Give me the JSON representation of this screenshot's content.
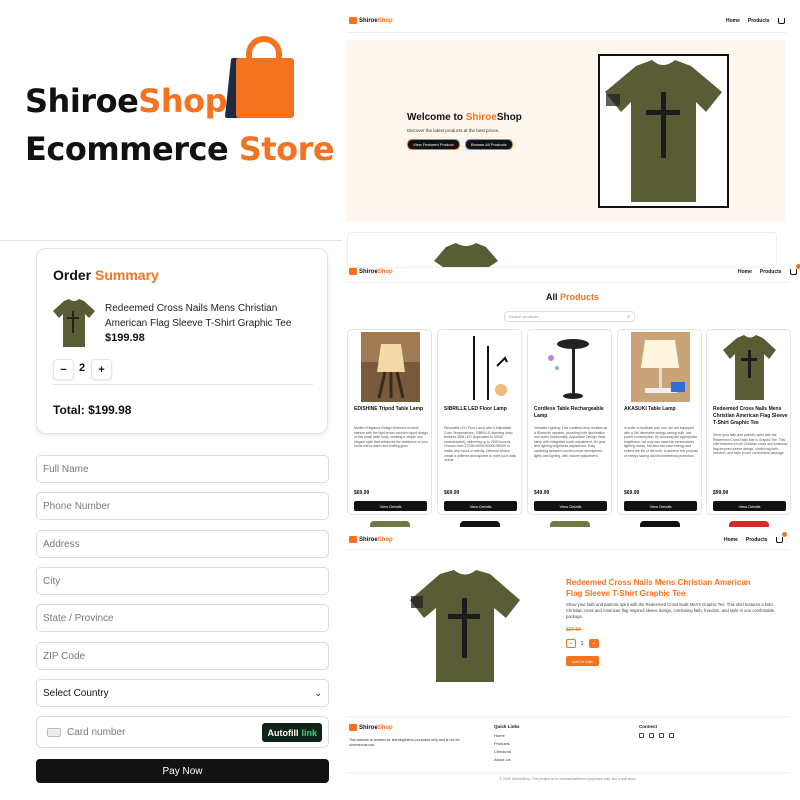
{
  "brand": {
    "line1_a": "Shiroe",
    "line1_b": "Shop",
    "line2_a": "Ecommerce",
    "line2_b": "Store"
  },
  "order": {
    "title_a": "Order",
    "title_b": "Summary",
    "item_title": "Redeemed Cross Nails Mens Christian American Flag Sleeve T-Shirt Graphic Tee",
    "item_price": "$199.98",
    "qty_minus": "−",
    "qty_value": "2",
    "qty_plus": "+",
    "total": "Total: $199.98"
  },
  "checkout": {
    "full_name": "Full Name",
    "phone": "Phone Number",
    "address": "Address",
    "city": "City",
    "state": "State / Province",
    "zip": "ZIP Code",
    "country": "Select Country",
    "card_number": "Card number",
    "autofill": "Autofill",
    "autofill_link": "link",
    "pay": "Pay Now"
  },
  "site": {
    "logo_a": "Shiroe",
    "logo_b": "Shop",
    "nav_home": "Home",
    "nav_products": "Products"
  },
  "hero": {
    "welcome": "Welcome to ",
    "welcome_a": "Shiroe",
    "welcome_b": "Shop",
    "subtitle": "Discover the latest products at the best prices.",
    "btn_featured": "View Featured Product",
    "btn_browse": "Browse All Products"
  },
  "products": {
    "title_a": "All",
    "title_b": "Products",
    "search_placeholder": "Search products...",
    "view_label": "View Details",
    "items": [
      {
        "name": "EDISHINE Tripod Table Lamp",
        "desc": "Modern Elegance Design:Embrace modern fashion with the light brown wooden tripod design of this small table lamp, creating a simple and elegant style that enhances the ambiance of your home with a warm and inviting glow.",
        "price": "$69.99"
      },
      {
        "name": "SIBRILLE LED Floor Lamp",
        "desc": "Dimmable LED Floor Lamp with 4 Adjustable Color Temperatures: SIBRILLE standing lamp features 36W LED (equivalent to 300W incandescent), delivering up to 2500 lumens. Choose from 2700K/4000K/5000K/6500K to match any mood or activity. Different Modes create a different atmosphere to meet your daily needs.",
        "price": "$69.99"
      },
      {
        "name": "Cordless Table Rechargeable Lamp",
        "desc": "Versatile Lighting: This cordless lamp doubles as a Bluetooth speaker, providing both illumination and audio functionality. Adjustable Design: Beat sleep with integrated touch adjustment, six gear limit lighting brightness adjustment. Easy switching between colorful music atmosphere lights and lighting, with volume adjustment.",
        "price": "$49.99"
      },
      {
        "name": "AKASUKI Table Lamp",
        "desc": "In order to facilitate your use, we are equipped with a 3W dimmable energy-saving bulb, low power consumption, by choosing the appropriate brightness, not only can meet the personalized lighting needs, but also can save energy and extend the life of the bulb, to achieve the purpose of energy saving and environmental protection.",
        "price": "$69.99"
      },
      {
        "name": "Redeemed Cross Nails Mens Christian American Flag Sleeve T-Shirt Graphic Tee",
        "desc": "Show your faith and patriotic spirit with the Redeemed Cross Nails Men's Graphic Tee. This shirt features a bold Christian cross and American flag-inspired sleeve design, combining faith, freedom, and style in one comfortable package.",
        "price": "$99.99"
      }
    ]
  },
  "detail": {
    "title": "Redeemed Cross Nails Mens Christian American Flag Sleeve T-Shirt Graphic Tee",
    "desc": "Show your faith and patriotic spirit with the Redeemed Cross Nails Men's Graphic Tee. This shirt features a bold Christian cross and American flag-inspired sleeve design, combining faith, freedom, and style in one comfortable package.",
    "price": "$99.99",
    "qty_minus": "−",
    "qty_value": "1",
    "qty_plus": "+",
    "add_to_cart": "Add to Cart"
  },
  "footer": {
    "about": "This website is created for learning/demo purposes only and is not for commercial use.",
    "quick_links": "Quick Links",
    "links": [
      "Home",
      "Products",
      "Checkout",
      "About Us"
    ],
    "connect": "Connect",
    "copyright": "© 2025 ShiroeShop. This project is for educational/demo purposes only. Not a real store."
  },
  "colors": {
    "accent": "#f47320",
    "dark": "#111111",
    "hero_bg": "#fff7ee",
    "shirt": "#5a5c36"
  },
  "icons": [
    "shopping-bag-logo-icon",
    "cart-icon",
    "search-icon",
    "chevron-down-icon",
    "credit-card-icon",
    "linkedin-icon",
    "github-icon",
    "email-icon",
    "phone-icon"
  ]
}
